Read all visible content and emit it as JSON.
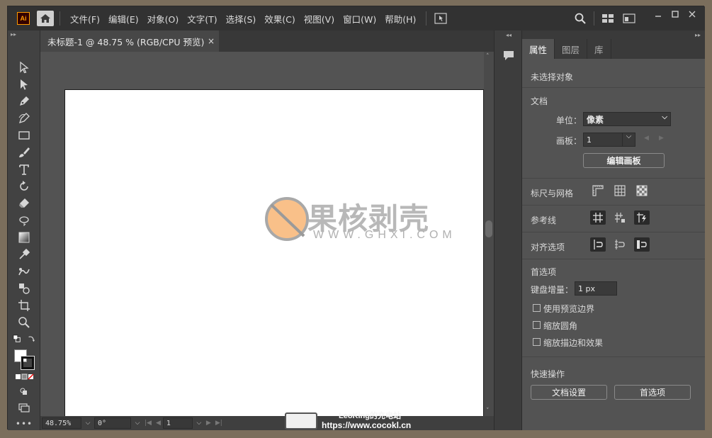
{
  "app": {
    "logo_text": "Ai"
  },
  "menu": {
    "items": [
      "文件(F)",
      "编辑(E)",
      "对象(O)",
      "文字(T)",
      "选择(S)",
      "效果(C)",
      "视图(V)",
      "窗口(W)",
      "帮助(H)"
    ]
  },
  "document": {
    "tab_title": "未标题-1 @ 48.75 % (RGB/CPU 预览)",
    "close_glyph": "×"
  },
  "status": {
    "zoom": "48.75%",
    "rotation": "0°",
    "artboard_num": "1"
  },
  "panel": {
    "tabs": [
      "属性",
      "图层",
      "库"
    ],
    "active_tab": "属性",
    "no_selection": "未选择对象",
    "doc_section": "文档",
    "unit_label": "单位：",
    "unit_value": "像素",
    "artboard_label": "画板：",
    "artboard_value": "1",
    "edit_artboards": "编辑画板",
    "rulers_grids": "标尺与网格",
    "guides": "参考线",
    "align_options": "对齐选项",
    "preferences": "首选项",
    "keyboard_increment_label": "键盘增量：",
    "keyboard_increment_value": "1 px",
    "checkboxes": [
      "使用预览边界",
      "缩放圆角",
      "缩放描边和效果"
    ],
    "quick_actions": "快速操作",
    "doc_setup_button": "文档设置",
    "prefs_button": "首选项"
  },
  "watermark": {
    "brand_cn": "果核剥壳",
    "brand_url": "WWW.GHXI.COM",
    "overlay_line1": "LeoKing的充电站",
    "overlay_line2": "https://www.cocokl.cn"
  },
  "colors": {
    "menubar": "#323232",
    "workspace": "#535353",
    "artboard": "#ffffff",
    "logo_orange": "#ff9a00",
    "watermark_orange": "#f9c089"
  }
}
